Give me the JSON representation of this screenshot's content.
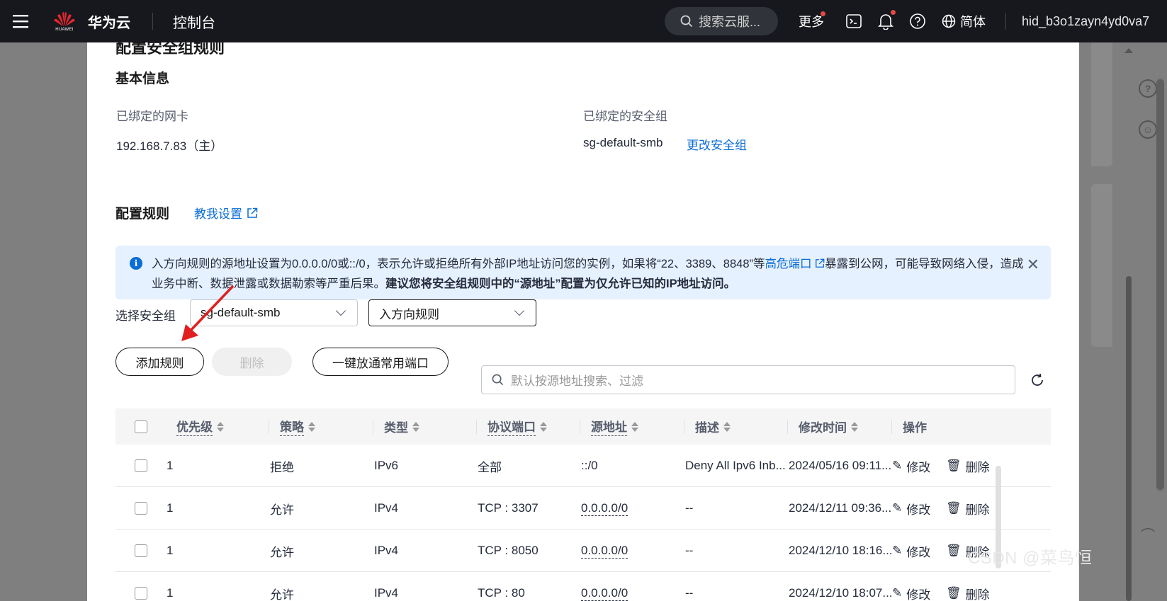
{
  "topbar": {
    "brand": "华为云",
    "logo_text": "HUAWEI",
    "console": "控制台",
    "search_placeholder": "搜索云服...",
    "more": "更多",
    "language": "简体",
    "user_id": "hid_b3o1zayn4yd0va7"
  },
  "panel": {
    "title": "配置安全组规则",
    "basic_info": {
      "heading": "基本信息",
      "nic_label": "已绑定的网卡",
      "nic_value": "192.168.7.83（主）",
      "sg_label": "已绑定的安全组",
      "sg_value": "sg-default-smb",
      "change_sg_link": "更改安全组"
    },
    "rules": {
      "heading": "配置规则",
      "teach_link": "教我设置"
    },
    "alert": {
      "text_1": "入方向规则的源地址设置为0.0.0.0/0或::/0，表示允许或拒绝所有外部IP地址访问您的实例，如果将“22、3389、8848”等",
      "link": "高危端口",
      "text_2": "暴露到公网，可能导致网络入侵，造成业务中断、数据泄露或数据勒索等严重后果。",
      "bold": "建议您将安全组规则中的“源地址”配置为仅允许已知的IP地址访问。"
    },
    "filters": {
      "select_label": "选择安全组",
      "sg_select_value": "sg-default-smb",
      "direction_select_value": "入方向规则"
    },
    "toolbar": {
      "add_rule": "添加规则",
      "delete": "删除",
      "open_common_ports": "一键放通常用端口",
      "search_placeholder": "默认按源地址搜索、过滤"
    },
    "table": {
      "columns": [
        "优先级",
        "策略",
        "类型",
        "协议端口",
        "源地址",
        "描述",
        "修改时间",
        "操作"
      ],
      "rows": [
        {
          "priority": "1",
          "policy": "拒绝",
          "type": "IPv6",
          "port": "全部",
          "source": "::/0",
          "desc": "Deny All Ipv6 Inb...",
          "time": "2024/05/16 09:11...",
          "edit": "修改",
          "del": "删除"
        },
        {
          "priority": "1",
          "policy": "允许",
          "type": "IPv4",
          "port": "TCP : 3307",
          "source": "0.0.0.0/0",
          "desc": "--",
          "time": "2024/12/11 09:36...",
          "edit": "修改",
          "del": "删除"
        },
        {
          "priority": "1",
          "policy": "允许",
          "type": "IPv4",
          "port": "TCP : 8050",
          "source": "0.0.0.0/0",
          "desc": "--",
          "time": "2024/12/10 18:16...",
          "edit": "修改",
          "del": "删除"
        },
        {
          "priority": "1",
          "policy": "允许",
          "type": "IPv4",
          "port": "TCP : 80",
          "source": "0.0.0.0/0",
          "desc": "--",
          "time": "2024/12/10 18:07...",
          "edit": "修改",
          "del": "删除"
        }
      ]
    }
  },
  "watermark": "CSDN @菜鸟恒",
  "colors": {
    "topbar_bg": "#16181d",
    "link_blue": "#0a6cd4",
    "alert_bg": "#e5f1fe",
    "annotation_red": "#e02020",
    "overlay": "#7f7f7f"
  }
}
